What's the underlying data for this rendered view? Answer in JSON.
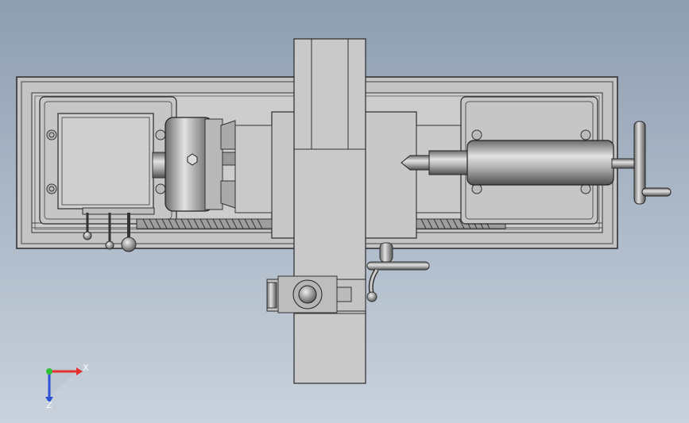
{
  "viewport": {
    "description_free": true,
    "background_top": "#8e9db1",
    "background_bottom": "#c9d2dc"
  },
  "model": {
    "parts": [
      "lathe-bed",
      "headstock",
      "chuck",
      "cross-slide",
      "tailstock",
      "handwheel",
      "lead-screw",
      "carriage-handle",
      "compound-rest"
    ],
    "colors": {
      "body": "#c8c8c8",
      "edge": "#2a2a2a",
      "shade": "#9a9a9a",
      "metal_dark": "#6e6e6e"
    }
  },
  "triad": {
    "x_label": "X",
    "z_label": "Z",
    "x_color": "#e53030",
    "y_color": "#2fbf3a",
    "z_color": "#2d52d6"
  }
}
